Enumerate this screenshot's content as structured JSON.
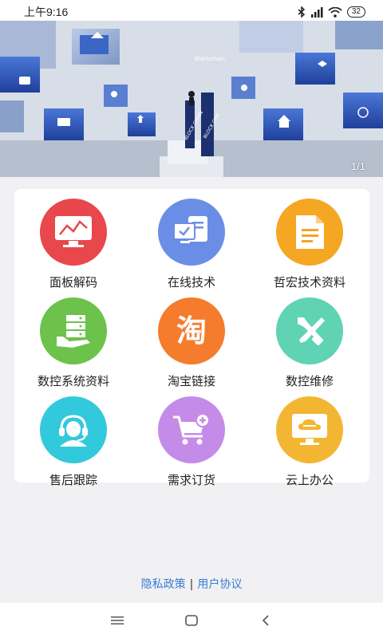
{
  "status_bar": {
    "time": "上午9:16",
    "battery": "32"
  },
  "banner": {
    "caption": "Blockchain",
    "counter": "1/1",
    "tower_text_1": "BLOCK CHAIN",
    "tower_text_2": "BLOCK CHA"
  },
  "menu": {
    "items": [
      {
        "label": "面板解码",
        "color": "#e8474b",
        "icon": "chart-monitor-icon"
      },
      {
        "label": "在线技术",
        "color": "#6a8ee6",
        "icon": "online-tech-icon"
      },
      {
        "label": "哲宏技术资料",
        "color": "#f5a623",
        "icon": "document-icon"
      },
      {
        "label": "数控系统资料",
        "color": "#6cc24a",
        "icon": "server-hand-icon"
      },
      {
        "label": "淘宝链接",
        "color": "#f47c2c",
        "icon": "taobao-icon"
      },
      {
        "label": "数控维修",
        "color": "#5fd3b4",
        "icon": "repair-tools-icon"
      },
      {
        "label": "售后跟踪",
        "color": "#33c9dc",
        "icon": "headset-support-icon"
      },
      {
        "label": "需求订货",
        "color": "#c58be8",
        "icon": "shopping-cart-icon"
      },
      {
        "label": "云上办公",
        "color": "#f2b632",
        "icon": "cloud-desktop-icon"
      }
    ]
  },
  "footer": {
    "privacy": "隐私政策",
    "separator": "|",
    "agreement": "用户协议"
  }
}
